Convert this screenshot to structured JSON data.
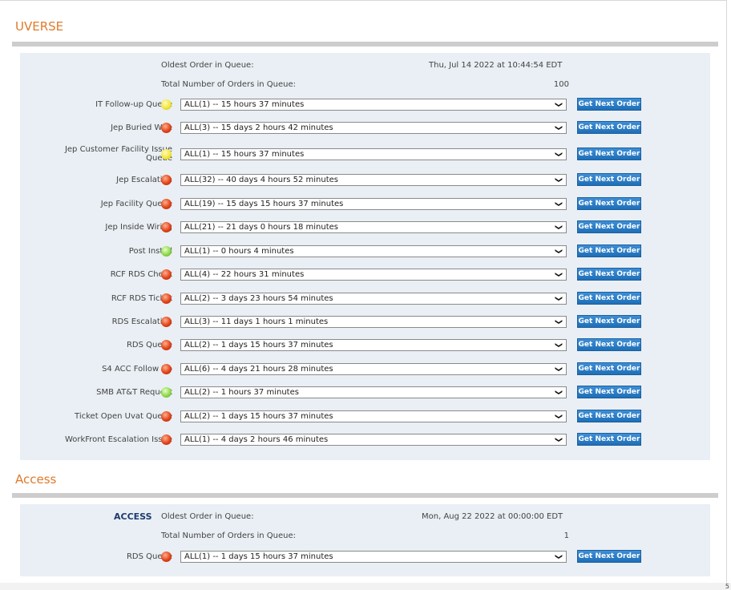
{
  "uverse": {
    "title": "UVERSE",
    "oldest_label": "Oldest Order in Queue:",
    "oldest_value": "Thu, Jul 14 2022 at 10:44:54 EDT",
    "total_label": "Total Number of Orders in Queue:",
    "total_value": "100",
    "button_label": "Get Next Order",
    "queues": [
      {
        "name": "IT Follow-up Queue",
        "status": "yellow",
        "value": "ALL(1) -- 15 hours 37 minutes"
      },
      {
        "name": "Jep Buried Wire",
        "status": "red",
        "value": "ALL(3) -- 15 days 2 hours 42 minutes"
      },
      {
        "name": "Jep Customer Facility Issue Queue",
        "status": "yellow",
        "value": "ALL(1) -- 15 hours 37 minutes"
      },
      {
        "name": "Jep Escalation",
        "status": "red",
        "value": "ALL(32) -- 40 days 4 hours 52 minutes"
      },
      {
        "name": "Jep Facility Queue",
        "status": "red",
        "value": "ALL(19) -- 15 days 15 hours 37 minutes"
      },
      {
        "name": "Jep Inside Wiring",
        "status": "red",
        "value": "ALL(21) -- 21 days 0 hours 18 minutes"
      },
      {
        "name": "Post Install",
        "status": "green",
        "value": "ALL(1) -- 0 hours 4 minutes"
      },
      {
        "name": "RCF RDS Check",
        "status": "red",
        "value": "ALL(4) -- 22 hours 31 minutes"
      },
      {
        "name": "RCF RDS Ticket",
        "status": "red",
        "value": "ALL(2) -- 3 days 23 hours 54 minutes"
      },
      {
        "name": "RDS Escalation",
        "status": "red",
        "value": "ALL(3) -- 11 days 1 hours 1 minutes"
      },
      {
        "name": "RDS Queue",
        "status": "red",
        "value": "ALL(2) -- 1 days 15 hours 37 minutes"
      },
      {
        "name": "S4 ACC Follow Up",
        "status": "red",
        "value": "ALL(6) -- 4 days 21 hours 28 minutes"
      },
      {
        "name": "SMB AT&T Request",
        "status": "green",
        "value": "ALL(2) -- 1 hours 37 minutes"
      },
      {
        "name": "Ticket Open Uvat Queue",
        "status": "red",
        "value": "ALL(2) -- 1 days 15 hours 37 minutes"
      },
      {
        "name": "WorkFront Escalation Issue",
        "status": "red",
        "value": "ALL(1) -- 4 days 2 hours 46 minutes"
      }
    ]
  },
  "access": {
    "title": "Access",
    "group_label": "ACCESS",
    "oldest_label": "Oldest Order in Queue:",
    "oldest_value": "Mon, Aug 22 2022 at 00:00:00 EDT",
    "total_label": "Total Number of Orders in Queue:",
    "total_value": "1",
    "button_label": "Get Next Order",
    "queues": [
      {
        "name": "RDS Queue",
        "status": "red",
        "value": "ALL(1) -- 1 days 15 hours 37 minutes"
      }
    ]
  },
  "page_number": "5",
  "chevron": "❯"
}
